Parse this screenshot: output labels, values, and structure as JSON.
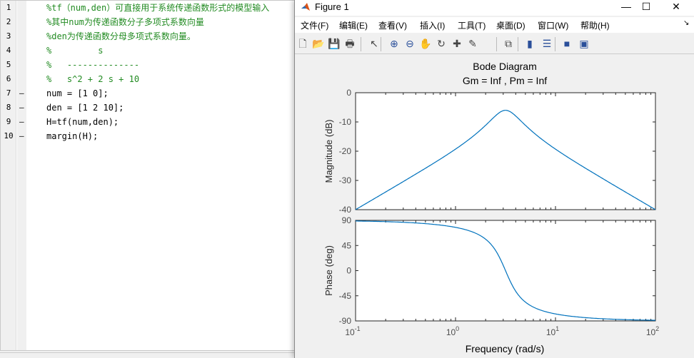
{
  "editor": {
    "lines": [
      {
        "n": "1",
        "dash": "",
        "text": "%tf（num,den）可直接用于系统传递函数形式的模型输入",
        "comment": true
      },
      {
        "n": "2",
        "dash": "",
        "text": "%其中num为传递函数分子多项式系数向量",
        "comment": true
      },
      {
        "n": "3",
        "dash": "",
        "text": "%den为传递函数分母多项式系数向量。",
        "comment": true
      },
      {
        "n": "4",
        "dash": "",
        "text": "%         s",
        "comment": true
      },
      {
        "n": "5",
        "dash": "",
        "text": "%   --------------",
        "comment": true
      },
      {
        "n": "6",
        "dash": "",
        "text": "%   s^2 + 2 s + 10",
        "comment": true
      },
      {
        "n": "7",
        "dash": "–",
        "text": "num = [1 0];",
        "comment": false
      },
      {
        "n": "8",
        "dash": "–",
        "text": "den = [1 2 10];",
        "comment": false
      },
      {
        "n": "9",
        "dash": "–",
        "text": "H=tf(num,den);",
        "comment": false
      },
      {
        "n": "10",
        "dash": "–",
        "text": "margin(H);",
        "comment": false
      }
    ]
  },
  "figure": {
    "title": "Figure 1",
    "minimize": "—",
    "maximize": "☐",
    "close": "✕",
    "menu": [
      "文件(F)",
      "编辑(E)",
      "查看(V)",
      "插入(I)",
      "工具(T)",
      "桌面(D)",
      "窗口(W)",
      "帮助(H)"
    ],
    "dock": "↘",
    "toolbar": [
      "new-icon",
      "open-icon",
      "save-icon",
      "print-icon",
      "pointer-icon",
      "zoom-in-icon",
      "zoom-out-icon",
      "pan-icon",
      "rotate-icon",
      "data-cursor-icon",
      "brush-icon",
      "link-icon",
      "colorbar-icon",
      "legend-icon",
      "hide-tools-icon",
      "show-tools-icon"
    ]
  },
  "chart_data": {
    "type": "line",
    "title": "Bode Diagram",
    "subtitle": "Gm = Inf ,  Pm = Inf",
    "xlabel": "Frequency  (rad/s)",
    "xscale": "log",
    "xlim": [
      0.1,
      100
    ],
    "xticks": [
      "10^-1",
      "10^0",
      "10^1",
      "10^2"
    ],
    "plots": [
      {
        "ylabel": "Magnitude (dB)",
        "ylim": [
          -40,
          0
        ],
        "yticks": [
          "0",
          "-10",
          "-20",
          "-30",
          "-40"
        ],
        "series": "20*log10(|H(jw)|)"
      },
      {
        "ylabel": "Phase (deg)",
        "ylim": [
          -90,
          90
        ],
        "yticks": [
          "90",
          "45",
          "0",
          "-45",
          "-90"
        ],
        "series": "angle(H(jw))"
      }
    ],
    "transfer_function": {
      "num": [
        1,
        0
      ],
      "den": [
        1,
        2,
        10
      ]
    },
    "color": "#0072bd"
  }
}
